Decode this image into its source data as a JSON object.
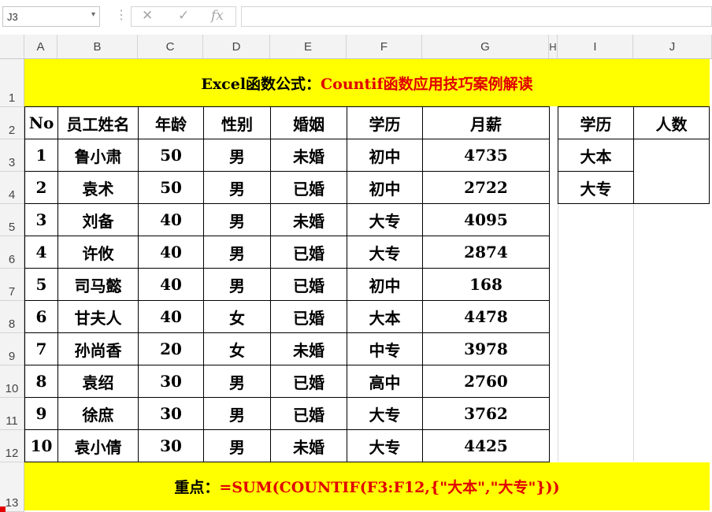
{
  "formula_bar": {
    "name_box": "J3",
    "cancel_icon": "✕",
    "enter_icon": "✓",
    "fx_icon": "fx",
    "formula": ""
  },
  "columns": [
    "A",
    "B",
    "C",
    "D",
    "E",
    "F",
    "G",
    "H",
    "I",
    "J"
  ],
  "rows": [
    "1",
    "2",
    "3",
    "4",
    "5",
    "6",
    "7",
    "8",
    "9",
    "10",
    "11",
    "12",
    "13"
  ],
  "title": {
    "prefix": "Excel函数公式：",
    "main": "Countif函数应用技巧案例解读"
  },
  "table": {
    "headers": [
      "No",
      "员工姓名",
      "年龄",
      "性别",
      "婚姻",
      "学历",
      "月薪"
    ],
    "rows": [
      [
        "1",
        "鲁小肃",
        "50",
        "男",
        "未婚",
        "初中",
        "4735"
      ],
      [
        "2",
        "袁术",
        "50",
        "男",
        "已婚",
        "初中",
        "2722"
      ],
      [
        "3",
        "刘备",
        "40",
        "男",
        "未婚",
        "大专",
        "4095"
      ],
      [
        "4",
        "许攸",
        "40",
        "男",
        "已婚",
        "大专",
        "2874"
      ],
      [
        "5",
        "司马懿",
        "40",
        "男",
        "已婚",
        "初中",
        "168"
      ],
      [
        "6",
        "甘夫人",
        "40",
        "女",
        "已婚",
        "大本",
        "4478"
      ],
      [
        "7",
        "孙尚香",
        "20",
        "女",
        "未婚",
        "中专",
        "3978"
      ],
      [
        "8",
        "袁绍",
        "30",
        "男",
        "已婚",
        "高中",
        "2760"
      ],
      [
        "9",
        "徐庶",
        "30",
        "男",
        "已婚",
        "大专",
        "3762"
      ],
      [
        "10",
        "袁小倩",
        "30",
        "男",
        "未婚",
        "大专",
        "4425"
      ]
    ]
  },
  "side_table": {
    "headers": [
      "学历",
      "人数"
    ],
    "items": [
      "大本",
      "大专"
    ],
    "count": ""
  },
  "footer": {
    "label": "重点：",
    "formula": "=SUM(COUNTIF(F3:F12,{\"大本\",\"大专\"}))"
  },
  "colors": {
    "banner": "#ffff00",
    "accent_red": "#e00000"
  }
}
